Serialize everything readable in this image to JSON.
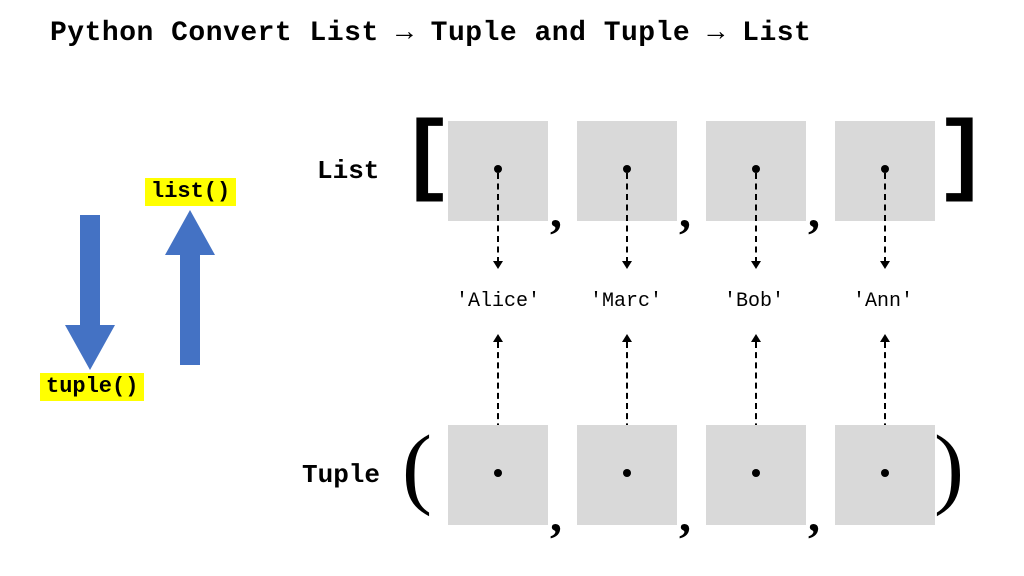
{
  "title_parts": {
    "p1": "Python Convert List ",
    "arrow": "→",
    "p2": " Tuple and Tuple ",
    "p3": " List"
  },
  "functions": {
    "to_list": "list()",
    "to_tuple": "tuple()"
  },
  "collections": {
    "list_label": "List",
    "tuple_label": "Tuple",
    "list_brackets": {
      "open": "[",
      "close": "]"
    },
    "tuple_parens": {
      "open": "(",
      "close": ")"
    },
    "separator": ","
  },
  "elements": [
    "'Alice'",
    "'Marc'",
    "'Bob'",
    "'Ann'"
  ],
  "colors": {
    "highlight": "#ffff00",
    "arrow": "#4472C4",
    "box": "#d9d9d9"
  }
}
